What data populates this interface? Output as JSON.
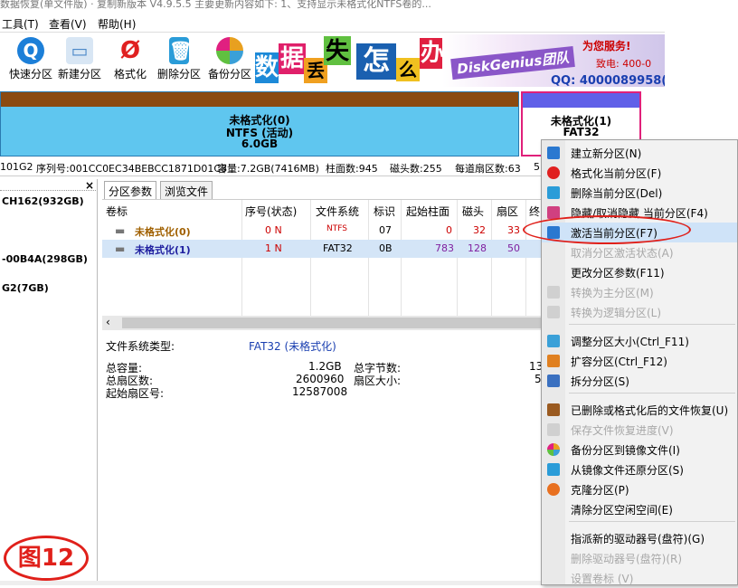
{
  "title_fragment": "数据恢复(单文件版) · 复制新版本 V4.9.5.5 主要更新内容如下: 1、支持显示未格式化NTFS卷的...",
  "menu": [
    {
      "label": "工具(T)"
    },
    {
      "label": "查看(V)"
    },
    {
      "label": "帮助(H)"
    }
  ],
  "toolbar": [
    {
      "label": "快速分区",
      "icon": "quick-partition-icon",
      "color": "#1c7fd8"
    },
    {
      "label": "新建分区",
      "icon": "new-partition-icon",
      "color": "#4b88c8"
    },
    {
      "label": "格式化",
      "icon": "format-icon",
      "color": "#e02020"
    },
    {
      "label": "删除分区",
      "icon": "delete-partition-icon",
      "color": "#2a9cd8"
    },
    {
      "label": "备份分区",
      "icon": "backup-partition-icon",
      "color": "#e8a020"
    }
  ],
  "banner": {
    "chars": [
      "数",
      "据",
      "丢",
      "失",
      "怎",
      "么",
      "办"
    ],
    "brand": "DiskGenius团队",
    "service": "为您服务!",
    "tel": "致电: 400-0",
    "qq": "QQ: 4000089958(与"
  },
  "disk": {
    "p1": {
      "name": "未格式化(0)",
      "fs": "NTFS (活动)",
      "size": "6.0GB"
    },
    "p2": {
      "name": "未格式化(1)",
      "fs": "FAT32"
    },
    "info": {
      "model": "101G2",
      "serial": "序列号:001CC0EC34BEBCC1871D01C8",
      "capacity": "容量:7.2GB(7416MB)",
      "cylinders": "柱面数:945",
      "heads": "磁头数:255",
      "sectors": "每道扇区数:63",
      "more": "5"
    }
  },
  "tree": [
    "CH162(932GB)",
    "-00B4A(298GB)",
    "G2(7GB)"
  ],
  "tabs": [
    "分区参数",
    "浏览文件"
  ],
  "table": {
    "headers": [
      "卷标",
      "序号(状态)",
      "文件系统",
      "标识",
      "起始柱面",
      "磁头",
      "扇区",
      "终"
    ],
    "rows": [
      {
        "label": "未格式化(0)",
        "seq": "0 N",
        "fs": "NTFS",
        "id": "07",
        "cyl": "0",
        "head": "32",
        "sec": "33"
      },
      {
        "label": "未格式化(1)",
        "seq": "1 N",
        "fs": "FAT32",
        "id": "0B",
        "cyl": "783",
        "head": "128",
        "sec": "50"
      }
    ]
  },
  "details": {
    "fs_type_label": "文件系统类型:",
    "fs_type_value": "FAT32 (未格式化)",
    "total_label": "总容量:",
    "total_value": "1.2GB",
    "sectors_label": "总扇区数:",
    "sectors_value": "2600960",
    "start_label": "起始扇区号:",
    "start_value": "12587008",
    "bytes_label": "总字节数:",
    "bytes_value": "13",
    "sector_size_label": "扇区大小:",
    "sector_size_value": "5"
  },
  "context_menu": [
    {
      "label": "建立新分区(N)",
      "icon": "new-partition-icon",
      "color": "#2a78d0",
      "disabled": false
    },
    {
      "label": "格式化当前分区(F)",
      "icon": "format-icon",
      "color": "#e02020",
      "disabled": false
    },
    {
      "label": "删除当前分区(Del)",
      "icon": "delete-icon",
      "color": "#2a9cd8",
      "disabled": false
    },
    {
      "label": "隐藏/取消隐藏 当前分区(F4)",
      "icon": "hide-icon",
      "color": "#d04080",
      "disabled": false
    },
    {
      "label": "激活当前分区(F7)",
      "icon": "activate-icon",
      "color": "#2a78d0",
      "disabled": false
    },
    {
      "label": "取消分区激活状态(A)",
      "icon": "deactivate-icon",
      "color": "#cccccc",
      "disabled": true
    },
    {
      "label": "更改分区参数(F11)",
      "icon": "",
      "color": "",
      "disabled": false
    },
    {
      "label": "转换为主分区(M)",
      "icon": "convert-primary-icon",
      "color": "#c0c0c0",
      "disabled": true
    },
    {
      "label": "转换为逻辑分区(L)",
      "icon": "convert-logical-icon",
      "color": "#c0c0c0",
      "disabled": true
    },
    {
      "label": "调整分区大小(Ctrl_F11)",
      "icon": "resize-icon",
      "color": "#3aa0d8",
      "disabled": false
    },
    {
      "label": "扩容分区(Ctrl_F12)",
      "icon": "expand-icon",
      "color": "#e08020",
      "disabled": false
    },
    {
      "label": "拆分分区(S)",
      "icon": "split-icon",
      "color": "#3a70c0",
      "disabled": false
    },
    {
      "label": "已删除或格式化后的文件恢复(U)",
      "icon": "recover-icon",
      "color": "#9a5a20",
      "disabled": false
    },
    {
      "label": "保存文件恢复进度(V)",
      "icon": "save-progress-icon",
      "color": "#c0c0c0",
      "disabled": true
    },
    {
      "label": "备份分区到镜像文件(I)",
      "icon": "backup-icon",
      "color": "#e8a020",
      "disabled": false
    },
    {
      "label": "从镜像文件还原分区(S)",
      "icon": "restore-icon",
      "color": "#2a9cd8",
      "disabled": false
    },
    {
      "label": "克隆分区(P)",
      "icon": "clone-icon",
      "color": "#e87020",
      "disabled": false
    },
    {
      "label": "清除分区空闲空间(E)",
      "icon": "",
      "color": "",
      "disabled": false
    },
    {
      "label": "指派新的驱动器号(盘符)(G)",
      "icon": "",
      "color": "",
      "disabled": false
    },
    {
      "label": "删除驱动器号(盘符)(R)",
      "icon": "",
      "color": "",
      "disabled": true
    },
    {
      "label": "设置卷标 (V)",
      "icon": "",
      "color": "",
      "disabled": true
    }
  ],
  "figure_label": "图12"
}
